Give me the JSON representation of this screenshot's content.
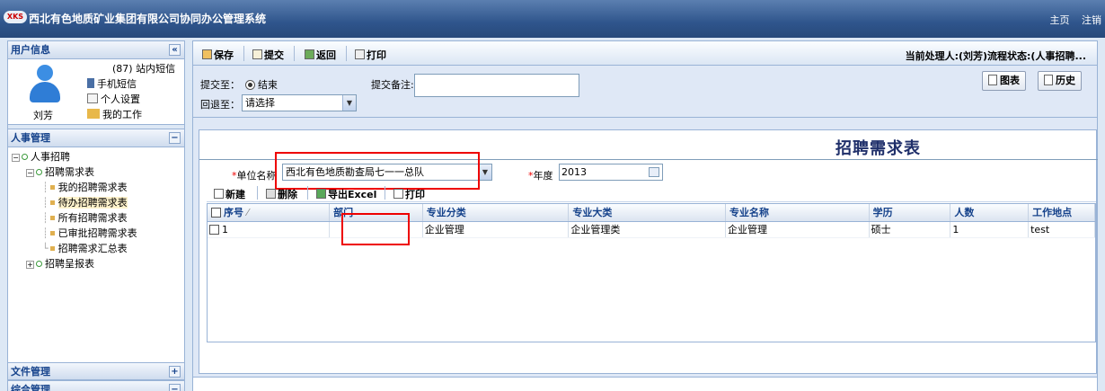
{
  "header": {
    "logo_text": "XKS",
    "title": "西北有色地质矿业集团有限公司协同办公管理系统",
    "links": [
      "主页",
      "注销"
    ]
  },
  "sidebar": {
    "user_panel_title": "用户信息",
    "user_name": "刘芳",
    "user_links": [
      "(87) 站内短信",
      "手机短信",
      "个人设置",
      "我的工作"
    ],
    "hr_panel_title": "人事管理",
    "tree": {
      "root": "人事招聘",
      "group": "招聘需求表",
      "leaves": [
        "我的招聘需求表",
        "待办招聘需求表",
        "所有招聘需求表",
        "已审批招聘需求表",
        "招聘需求汇总表"
      ],
      "collapsed": "招聘呈报表"
    },
    "bottom_panels": [
      "文件管理",
      "综合管理"
    ],
    "collapse_glyph": "«",
    "minus_glyph": "−",
    "plus_glyph": "+"
  },
  "toolbar": {
    "save": "保存",
    "submit": "提交",
    "back": "返回",
    "print": "打印",
    "handler_info": "当前处理人:(刘芳)流程状态:(人事招聘..."
  },
  "submit_area": {
    "submit_to_label": "提交至：",
    "submit_to_option": "结束",
    "return_to_label": "回退至：",
    "return_to_value": "请选择",
    "remark_label": "提交备注:",
    "remark_value": "",
    "chart_button": "图表",
    "history_button": "历史"
  },
  "form": {
    "title": "招聘需求表",
    "unit_label": "单位名称",
    "unit_value": "西北有色地质勘查局七一一总队",
    "year_label": "年度",
    "year_value": "2013",
    "required_mark": "*",
    "grid_buttons": [
      "新建",
      "删除",
      "导出Excel",
      "打印"
    ]
  },
  "grid": {
    "columns": [
      "序号",
      "部门",
      "专业分类",
      "专业大类",
      "专业名称",
      "学历",
      "人数",
      "工作地点"
    ],
    "rows": [
      [
        "1",
        "",
        "企业管理",
        "企业管理类",
        "企业管理",
        "硕士",
        "1",
        "test"
      ]
    ]
  },
  "colors": {
    "header_blue": "#2f558c",
    "highlight_red": "#ee0000",
    "title_navy": "#1f2f6a"
  }
}
